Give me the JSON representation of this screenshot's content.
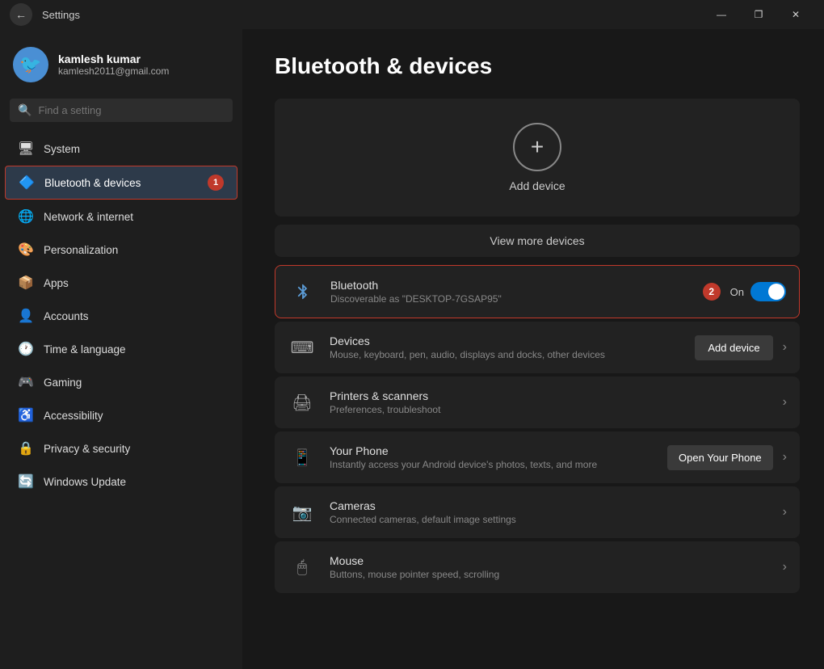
{
  "titlebar": {
    "title": "Settings",
    "back_symbol": "←",
    "minimize": "—",
    "maximize": "❐",
    "close": "✕"
  },
  "sidebar": {
    "user": {
      "name": "kamlesh kumar",
      "email": "kamlesh2011@gmail.com",
      "avatar_emoji": "🐦"
    },
    "search_placeholder": "Find a setting",
    "items": [
      {
        "id": "system",
        "label": "System",
        "icon": "🖥",
        "active": false
      },
      {
        "id": "bluetooth",
        "label": "Bluetooth & devices",
        "icon": "🔷",
        "active": true,
        "badge": "1"
      },
      {
        "id": "network",
        "label": "Network & internet",
        "icon": "🌐",
        "active": false
      },
      {
        "id": "personalization",
        "label": "Personalization",
        "icon": "🎨",
        "active": false
      },
      {
        "id": "apps",
        "label": "Apps",
        "icon": "📦",
        "active": false
      },
      {
        "id": "accounts",
        "label": "Accounts",
        "icon": "👤",
        "active": false
      },
      {
        "id": "time",
        "label": "Time & language",
        "icon": "🕐",
        "active": false
      },
      {
        "id": "gaming",
        "label": "Gaming",
        "icon": "🎮",
        "active": false
      },
      {
        "id": "accessibility",
        "label": "Accessibility",
        "icon": "♿",
        "active": false
      },
      {
        "id": "privacy",
        "label": "Privacy & security",
        "icon": "🔒",
        "active": false
      },
      {
        "id": "update",
        "label": "Windows Update",
        "icon": "🔄",
        "active": false
      }
    ]
  },
  "content": {
    "page_title": "Bluetooth & devices",
    "add_device_label": "Add device",
    "view_more_label": "View more devices",
    "bluetooth": {
      "title": "Bluetooth",
      "subtitle": "Discoverable as \"DESKTOP-7GSAP95\"",
      "status": "On",
      "enabled": true,
      "step_badge": "2"
    },
    "rows": [
      {
        "id": "devices",
        "icon": "⌨",
        "title": "Devices",
        "subtitle": "Mouse, keyboard, pen, audio, displays and docks, other devices",
        "action_label": "Add device",
        "has_chevron": true
      },
      {
        "id": "printers",
        "icon": "🖨",
        "title": "Printers & scanners",
        "subtitle": "Preferences, troubleshoot",
        "has_chevron": true
      },
      {
        "id": "yourphone",
        "icon": "📱",
        "title": "Your Phone",
        "subtitle": "Instantly access your Android device's photos, texts, and more",
        "action_label": "Open Your Phone",
        "has_chevron": true
      },
      {
        "id": "cameras",
        "icon": "📷",
        "title": "Cameras",
        "subtitle": "Connected cameras, default image settings",
        "has_chevron": true
      },
      {
        "id": "mouse",
        "icon": "🖱",
        "title": "Mouse",
        "subtitle": "Buttons, mouse pointer speed, scrolling",
        "has_chevron": true
      }
    ]
  }
}
